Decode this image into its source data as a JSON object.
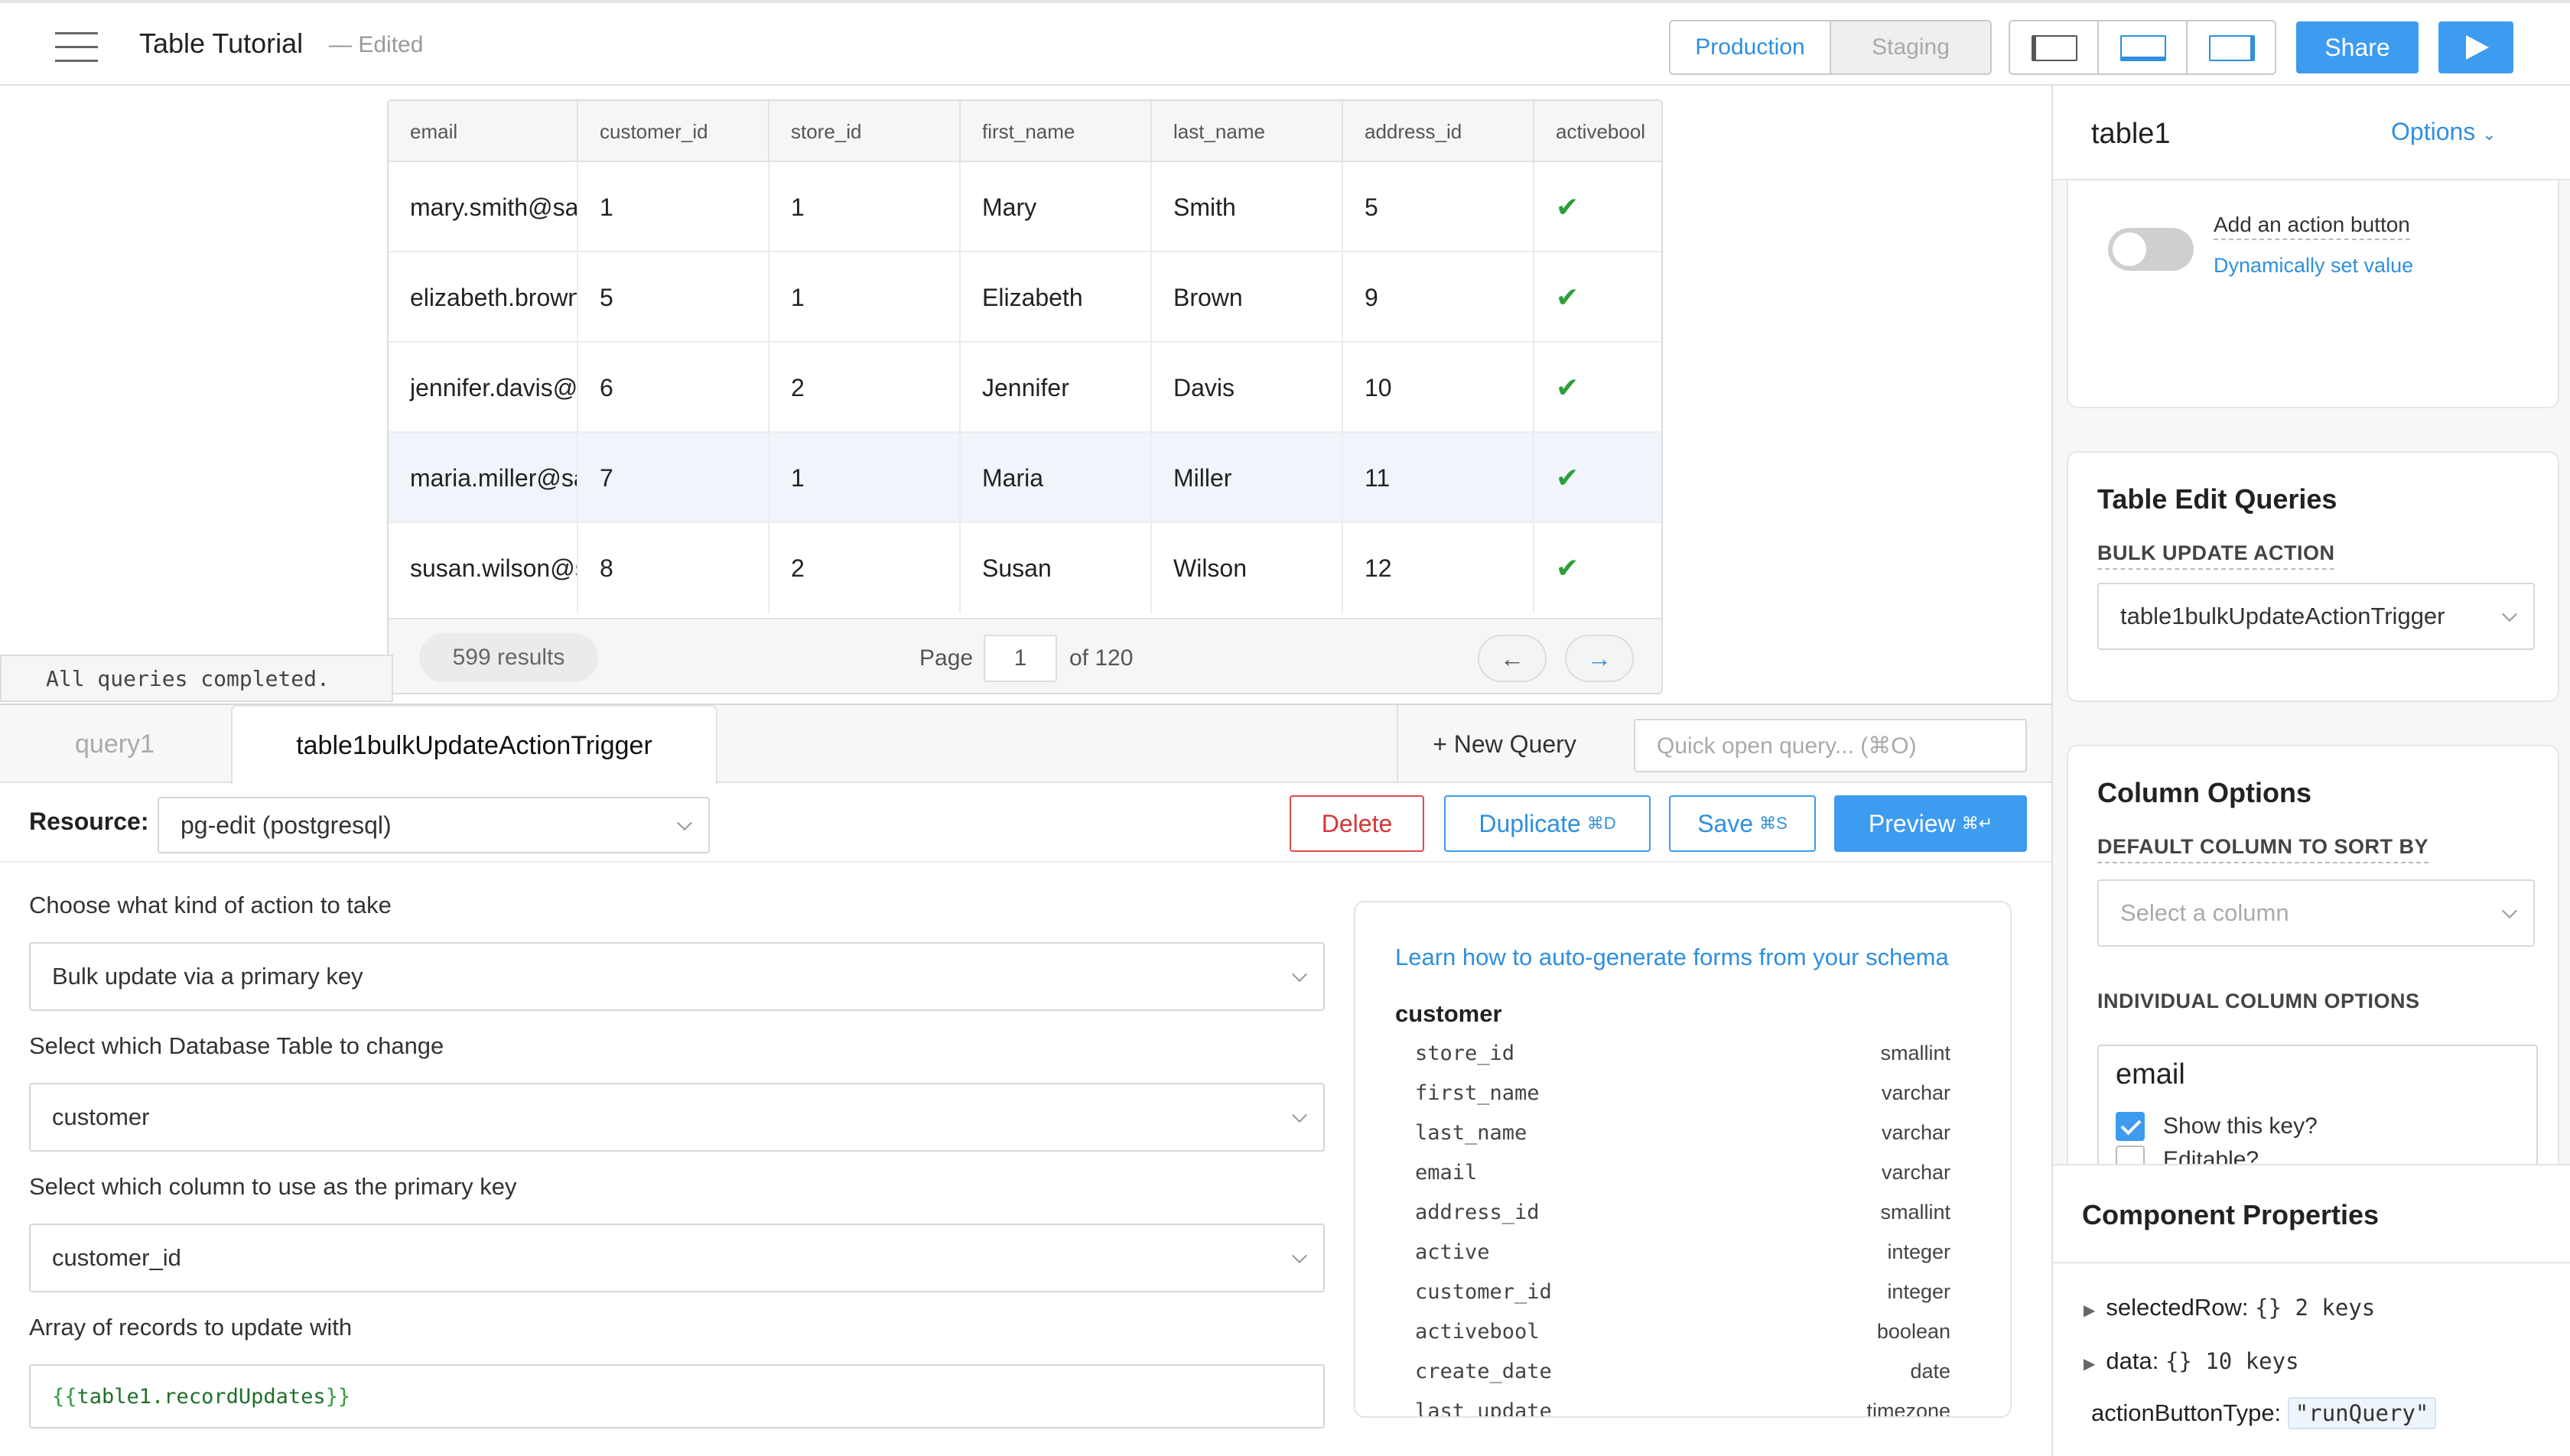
{
  "header": {
    "title": "Table Tutorial",
    "edited": "— Edited",
    "env_production": "Production",
    "env_staging": "Staging",
    "share_label": "Share"
  },
  "table": {
    "columns": [
      "email",
      "customer_id",
      "store_id",
      "first_name",
      "last_name",
      "address_id",
      "activebool"
    ],
    "rows": [
      [
        "mary.smith@sa",
        "1",
        "1",
        "Mary",
        "Smith",
        "5",
        "✔"
      ],
      [
        "elizabeth.brown",
        "5",
        "1",
        "Elizabeth",
        "Brown",
        "9",
        "✔"
      ],
      [
        "jennifer.davis@",
        "6",
        "2",
        "Jennifer",
        "Davis",
        "10",
        "✔"
      ],
      [
        "maria.miller@sa",
        "7",
        "1",
        "Maria",
        "Miller",
        "11",
        "✔"
      ],
      [
        "susan.wilson@s",
        "8",
        "2",
        "Susan",
        "Wilson",
        "12",
        "✔"
      ]
    ],
    "results": "599 results",
    "page_label": "Page",
    "page_value": "1",
    "of_pages": "of 120",
    "prev_icon": "arrow-left-icon",
    "next_icon": "arrow-right-icon"
  },
  "console": {
    "message": "All queries completed."
  },
  "editor": {
    "tabs": [
      {
        "label": "query1",
        "active": false
      },
      {
        "label": "table1bulkUpdateActionTrigger",
        "active": true
      }
    ],
    "new_query": "+ New Query",
    "quick_open_placeholder": "Quick open query... (⌘O)",
    "resource_label": "Resource:",
    "resource_value": "pg-edit (postgresql)",
    "delete_label": "Delete",
    "duplicate_label": "Duplicate",
    "duplicate_shortcut": "⌘D",
    "save_label": "Save",
    "save_shortcut": "⌘S",
    "preview_label": "Preview",
    "preview_shortcut": "⌘↵",
    "action_label": "Choose what kind of action to take",
    "action_value": "Bulk update via a primary key",
    "table_label": "Select which Database Table to change",
    "table_value": "customer",
    "pk_label": "Select which column to use as the primary key",
    "pk_value": "customer_id",
    "records_label": "Array of records to update with",
    "records_open": "{{",
    "records_expr": " table1.recordUpdates ",
    "records_close": "}}"
  },
  "schema": {
    "link": "Learn how to auto-generate forms from your schema",
    "table_name": "customer",
    "columns": [
      {
        "name": "store_id",
        "type": "smallint"
      },
      {
        "name": "first_name",
        "type": "varchar"
      },
      {
        "name": "last_name",
        "type": "varchar"
      },
      {
        "name": "email",
        "type": "varchar"
      },
      {
        "name": "address_id",
        "type": "smallint"
      },
      {
        "name": "active",
        "type": "integer"
      },
      {
        "name": "customer_id",
        "type": "integer"
      },
      {
        "name": "activebool",
        "type": "boolean"
      },
      {
        "name": "create_date",
        "type": "date"
      },
      {
        "name": "last_update",
        "type": "timezone"
      }
    ]
  },
  "inspector": {
    "component": "table1",
    "options": "Options",
    "action_button_label": "Add an action button",
    "dynamic_link": "Dynamically set value",
    "edit_queries_title": "Table Edit Queries",
    "bulk_update_caption": "BULK UPDATE ACTION",
    "bulk_update_value": "table1bulkUpdateActionTrigger",
    "column_options_title": "Column Options",
    "default_sort_caption": "DEFAULT COLUMN TO SORT BY",
    "default_sort_placeholder": "Select a column",
    "individual_caption": "INDIVIDUAL COLUMN OPTIONS",
    "column_name": "email",
    "show_key_label": "Show this key?",
    "editable_label": "Editable?",
    "props_title": "Component Properties",
    "prop_selected_row": "selectedRow:",
    "prop_selected_row_val": "{}  2 keys",
    "prop_data": "data:",
    "prop_data_val": "{}  10 keys",
    "prop_action_type": "actionButtonType:",
    "prop_action_type_val": "\"runQuery\""
  },
  "colors": {
    "accent": "#3d9bf0",
    "danger": "#d83434",
    "success": "#2e9e3a"
  }
}
